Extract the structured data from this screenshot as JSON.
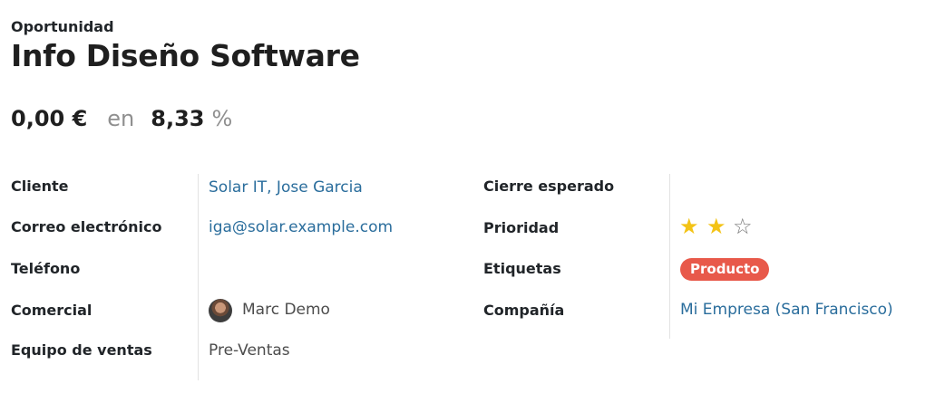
{
  "header": {
    "form_type": "Oportunidad",
    "title": "Info Diseño Software"
  },
  "revenue": {
    "amount": "0,00 €",
    "on_label": "en",
    "probability": "8,33",
    "percent_sign": "%"
  },
  "left_fields": {
    "customer": {
      "label": "Cliente",
      "value": "Solar IT, Jose Garcia"
    },
    "email": {
      "label": "Correo electrónico",
      "value": "iga@solar.example.com"
    },
    "phone": {
      "label": "Teléfono",
      "value": ""
    },
    "salesperson": {
      "label": "Comercial",
      "value": "Marc Demo"
    },
    "sales_team": {
      "label": "Equipo de ventas",
      "value": "Pre-Ventas"
    }
  },
  "right_fields": {
    "expected_closing": {
      "label": "Cierre esperado",
      "value": ""
    },
    "priority": {
      "label": "Prioridad",
      "stars_total": 3,
      "stars_filled": 2
    },
    "tags": {
      "label": "Etiquetas",
      "items": [
        "Producto"
      ],
      "tag_color": "#e8594a"
    },
    "company": {
      "label": "Compañía",
      "value": "Mi Empresa (San Francisco)"
    }
  },
  "colors": {
    "link": "#2a6d9c",
    "star_filled": "#f3c316",
    "star_empty": "#7a7a7a",
    "muted": "#8f8f8f"
  }
}
